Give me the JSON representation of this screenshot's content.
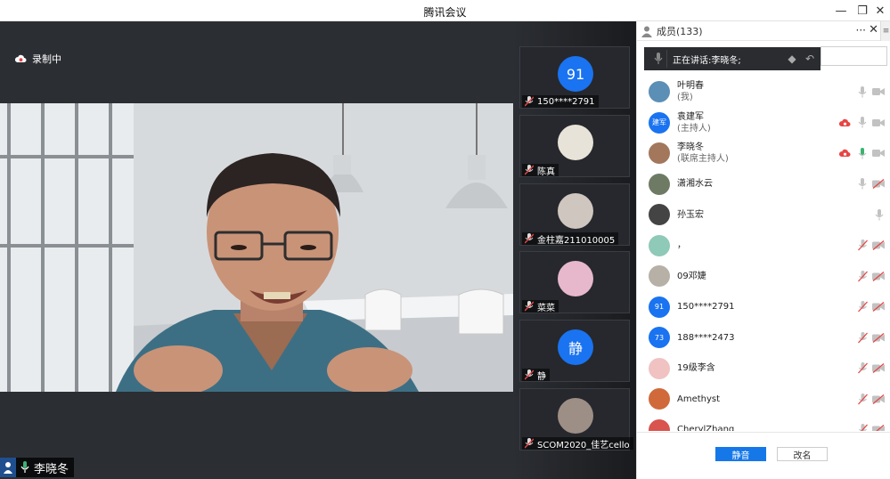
{
  "window": {
    "title": "腾讯会议",
    "minimize": "—",
    "restore": "❐",
    "close": "✕"
  },
  "stage": {
    "recording_label": "录制中",
    "active_speaker": "李晓冬"
  },
  "thumbnails": [
    {
      "name": "150****2791",
      "avatar_text": "91",
      "avatar_color": "#1a73f0"
    },
    {
      "name": "陈真",
      "avatar_text": "",
      "avatar_color": "#e8e3d8"
    },
    {
      "name": "金柱嘉211010005",
      "avatar_text": "",
      "avatar_color": "#cfc6bf"
    },
    {
      "name": "菜菜",
      "avatar_text": "",
      "avatar_color": "#e7b8cc"
    },
    {
      "name": "静",
      "avatar_text": "静",
      "avatar_color": "#1a73f0"
    },
    {
      "name": "SCOM2020_佳艺cello",
      "avatar_text": "",
      "avatar_color": "#9e8f86"
    }
  ],
  "panel": {
    "title": "成员(133)",
    "more": "···",
    "close": "✕",
    "grip": "≡",
    "speaking_prefix": "正在讲话: ",
    "speaking_name": "李晓冬;",
    "mute_all_label": "静音",
    "rename_label": "改名"
  },
  "members": [
    {
      "name": "叶明春",
      "role": "(我)",
      "avatar_text": "",
      "avatar_color": "#5b8fb6",
      "mic": "on",
      "cam": "on",
      "rec": false
    },
    {
      "name": "袁建军",
      "role": "(主持人)",
      "avatar_text": "建军",
      "avatar_color": "#1a73f0",
      "mic": "on",
      "cam": "on",
      "rec": true
    },
    {
      "name": "李晓冬",
      "role": "(联席主持人)",
      "avatar_text": "",
      "avatar_color": "#a2775c",
      "mic": "speaking",
      "cam": "on",
      "rec": true
    },
    {
      "name": "潇湘水云",
      "role": "",
      "avatar_text": "",
      "avatar_color": "#6f7a65",
      "mic": "on",
      "cam": "off",
      "rec": false
    },
    {
      "name": "孙玉宏",
      "role": "",
      "avatar_text": "",
      "avatar_color": "#444444",
      "mic": "on",
      "cam": "none",
      "rec": false
    },
    {
      "name": "，",
      "role": "",
      "avatar_text": "",
      "avatar_color": "#8fc9b8",
      "mic": "off",
      "cam": "off",
      "rec": false
    },
    {
      "name": "09邓婕",
      "role": "",
      "avatar_text": "",
      "avatar_color": "#b7b0a6",
      "mic": "off",
      "cam": "off",
      "rec": false
    },
    {
      "name": "150****2791",
      "role": "",
      "avatar_text": "91",
      "avatar_color": "#1a73f0",
      "mic": "off",
      "cam": "off",
      "rec": false
    },
    {
      "name": "188****2473",
      "role": "",
      "avatar_text": "73",
      "avatar_color": "#1a73f0",
      "mic": "off",
      "cam": "off",
      "rec": false
    },
    {
      "name": "19级李含",
      "role": "",
      "avatar_text": "",
      "avatar_color": "#f0c2c2",
      "mic": "off",
      "cam": "off",
      "rec": false
    },
    {
      "name": "Amethyst",
      "role": "",
      "avatar_text": "",
      "avatar_color": "#d06a3a",
      "mic": "off",
      "cam": "off",
      "rec": false
    },
    {
      "name": "CherylZhang",
      "role": "",
      "avatar_text": "",
      "avatar_color": "#d9534f",
      "mic": "off",
      "cam": "off",
      "rec": false
    }
  ],
  "colors": {
    "accent": "#1678e8",
    "recording": "#e64545",
    "speaking": "#3cb371",
    "muted": "#e64545",
    "icon_grey": "#b5b5b5"
  }
}
